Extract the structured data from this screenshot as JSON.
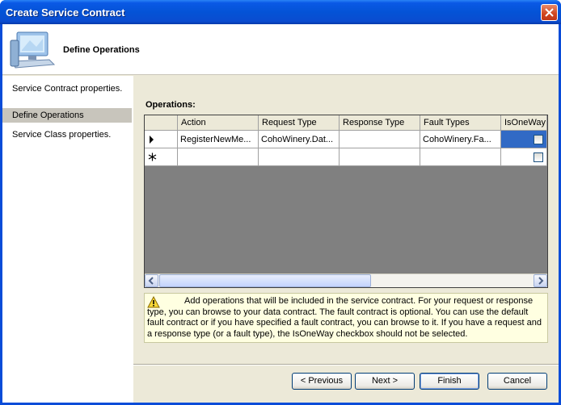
{
  "window": {
    "title": "Create Service Contract"
  },
  "header": {
    "title": "Define Operations"
  },
  "sidebar": {
    "items": [
      {
        "label": "Service Contract properties."
      },
      {
        "label": "Define Operations",
        "selected": true
      },
      {
        "label": "Service Class properties."
      }
    ]
  },
  "operations": {
    "label": "Operations:",
    "columns": [
      "Action",
      "Request Type",
      "Response Type",
      "Fault Types",
      "IsOneWay"
    ],
    "rows": [
      {
        "marker": "current-row",
        "action": "RegisterNewMe...",
        "request_type": "CohoWinery.Dat...",
        "response_type": "",
        "fault_types": "CohoWinery.Fa...",
        "is_one_way": false
      },
      {
        "marker": "new-row",
        "action": "",
        "request_type": "",
        "response_type": "",
        "fault_types": "",
        "is_one_way": false
      }
    ]
  },
  "info": {
    "icon": "warning-icon",
    "text": "Add operations that will be included in the service contract. For your request or response type, you can browse to your data contract. The fault contract is optional. You can use the default fault contract or if you have specified a fault contract, you can browse to it. If you have a request and a response type (or a fault type), the IsOneWay checkbox should not be selected."
  },
  "buttons": {
    "previous": "< Previous",
    "next": "Next >",
    "finish": "Finish",
    "cancel": "Cancel"
  },
  "colors": {
    "titlebar": "#0453d6",
    "selection": "#316ac5",
    "info_background": "#ffffe1"
  }
}
